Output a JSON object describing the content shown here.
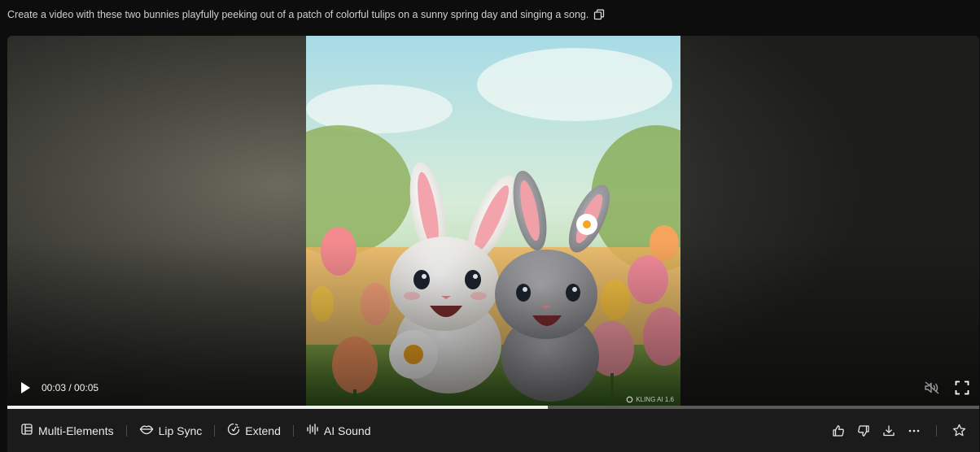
{
  "prompt": {
    "text": "Create a video with these two bunnies playfully peeking out of a patch of colorful tulips on a sunny spring day and singing a song.",
    "copy_icon": "copy-icon"
  },
  "player": {
    "time_display": "00:03 / 00:05",
    "progress": 0.556,
    "watermark": "KLING AI 1.6",
    "muted": true
  },
  "toolbar": {
    "tools": [
      {
        "label": "Multi-Elements",
        "icon": "multi-elements-icon"
      },
      {
        "label": "Lip Sync",
        "icon": "lips-icon"
      },
      {
        "label": "Extend",
        "icon": "extend-icon"
      },
      {
        "label": "AI Sound",
        "icon": "sound-wave-icon"
      }
    ],
    "actions": [
      "thumbs-up-icon",
      "thumbs-down-icon",
      "download-icon",
      "more-icon",
      "star-icon"
    ]
  },
  "colors": {
    "background": "#0d0d0d",
    "toolbar": "#1b1b1b",
    "progress_fill": "#f0f0f0",
    "progress_track": "#5a5a5a"
  }
}
